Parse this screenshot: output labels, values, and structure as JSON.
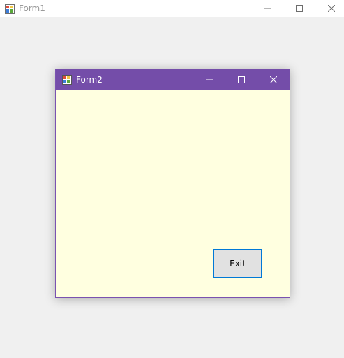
{
  "form1": {
    "title": "Form1",
    "icon": "app-form-icon",
    "controls": [
      "minimize-icon",
      "maximize-icon",
      "close-icon"
    ]
  },
  "form2": {
    "title": "Form2",
    "icon": "app-form-icon",
    "titlebar_color": "#744da9",
    "client_color": "#ffffe0",
    "controls": [
      "minimize-icon",
      "maximize-icon",
      "close-icon"
    ],
    "exit_label": "Exit"
  }
}
